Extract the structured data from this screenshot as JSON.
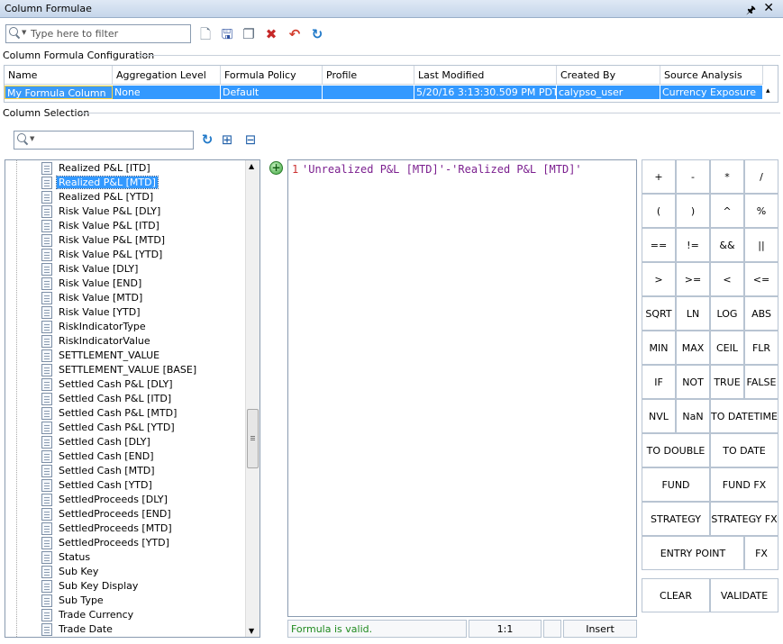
{
  "window": {
    "title": "Column Formulae"
  },
  "toolbar": {
    "filter_placeholder": "Type here to filter"
  },
  "config": {
    "section_label": "Column Formula Configuration",
    "columns": [
      "Name",
      "Aggregation Level",
      "Formula Policy",
      "Profile",
      "Last Modified",
      "Created By",
      "Source Analysis"
    ],
    "row": [
      "My Formula Column",
      "None",
      "Default",
      "",
      "5/20/16 3:13:30.509 PM PDT",
      "calypso_user",
      "Currency Exposure"
    ]
  },
  "selection": {
    "section_label": "Column Selection",
    "items": [
      "Realized P&L [ITD]",
      "Realized P&L [MTD]",
      "Realized P&L [YTD]",
      "Risk Value P&L [DLY]",
      "Risk Value P&L [ITD]",
      "Risk Value P&L [MTD]",
      "Risk Value P&L [YTD]",
      "Risk Value [DLY]",
      "Risk Value [END]",
      "Risk Value [MTD]",
      "Risk Value [YTD]",
      "RiskIndicatorType",
      "RiskIndicatorValue",
      "SETTLEMENT_VALUE",
      "SETTLEMENT_VALUE [BASE]",
      "Settled Cash P&L [DLY]",
      "Settled Cash P&L [ITD]",
      "Settled Cash P&L [MTD]",
      "Settled Cash P&L [YTD]",
      "Settled Cash [DLY]",
      "Settled Cash [END]",
      "Settled Cash [MTD]",
      "Settled Cash [YTD]",
      "SettledProceeds [DLY]",
      "SettledProceeds [END]",
      "SettledProceeds [MTD]",
      "SettledProceeds [YTD]",
      "Status",
      "Sub Key",
      "Sub Key Display",
      "Sub Type",
      "Trade Currency",
      "Trade Date"
    ],
    "selected_index": 1
  },
  "editor": {
    "line_number": "1",
    "code": "'Unrealized P&L [MTD]'-'Realized P&L [MTD]'"
  },
  "status": {
    "message": "Formula is valid.",
    "position": "1:1",
    "mode": "Insert"
  },
  "calculator": {
    "ops": [
      "+",
      "-",
      "*",
      "/",
      "(",
      ")",
      "^",
      "%",
      "==",
      "!=",
      "&&",
      "||",
      ">",
      ">=",
      "<",
      "<=",
      "SQRT",
      "LN",
      "LOG",
      "ABS",
      "MIN",
      "MAX",
      "CEIL",
      "FLR",
      "IF",
      "NOT",
      "TRUE",
      "FALSE",
      "NVL",
      "NaN",
      "TO DATETIME"
    ],
    "wide": [
      "TO DOUBLE",
      "TO DATE",
      "FUND",
      "FUND FX",
      "STRATEGY",
      "STRATEGY FX"
    ],
    "entry_point": "ENTRY POINT",
    "fx": "FX",
    "clear": "CLEAR",
    "validate": "VALIDATE"
  }
}
